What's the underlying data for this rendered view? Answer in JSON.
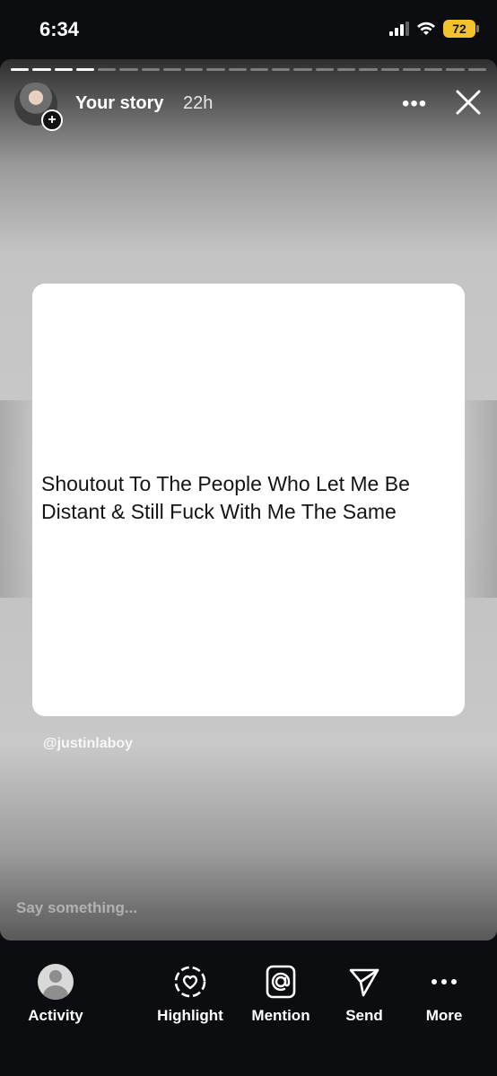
{
  "status_bar": {
    "time": "6:34",
    "battery": "72",
    "icons": [
      "cellular-signal-icon",
      "wifi-icon",
      "battery-icon"
    ]
  },
  "story": {
    "progress_segments_total": 22,
    "progress_segments_viewed": 4,
    "username": "Your story",
    "time_ago": "22h",
    "more_icon": "ellipsis-icon",
    "close_icon": "close-icon",
    "post_text": "Shoutout To The People Who Let Me Be Distant & Still Fuck With Me The Same",
    "credit": "@justinlaboy",
    "reply_placeholder": "Say something..."
  },
  "tabbar": {
    "items": [
      {
        "label": "Activity",
        "icon": "profile-avatar-icon"
      },
      {
        "label": "Highlight",
        "icon": "heart-circle-icon"
      },
      {
        "label": "Mention",
        "icon": "at-sign-icon"
      },
      {
        "label": "Send",
        "icon": "paper-plane-icon"
      },
      {
        "label": "More",
        "icon": "ellipsis-icon"
      }
    ]
  },
  "colors": {
    "background": "#0b0d10",
    "battery": "#f4c22b",
    "card": "#ffffff",
    "post_text": "#141414"
  }
}
